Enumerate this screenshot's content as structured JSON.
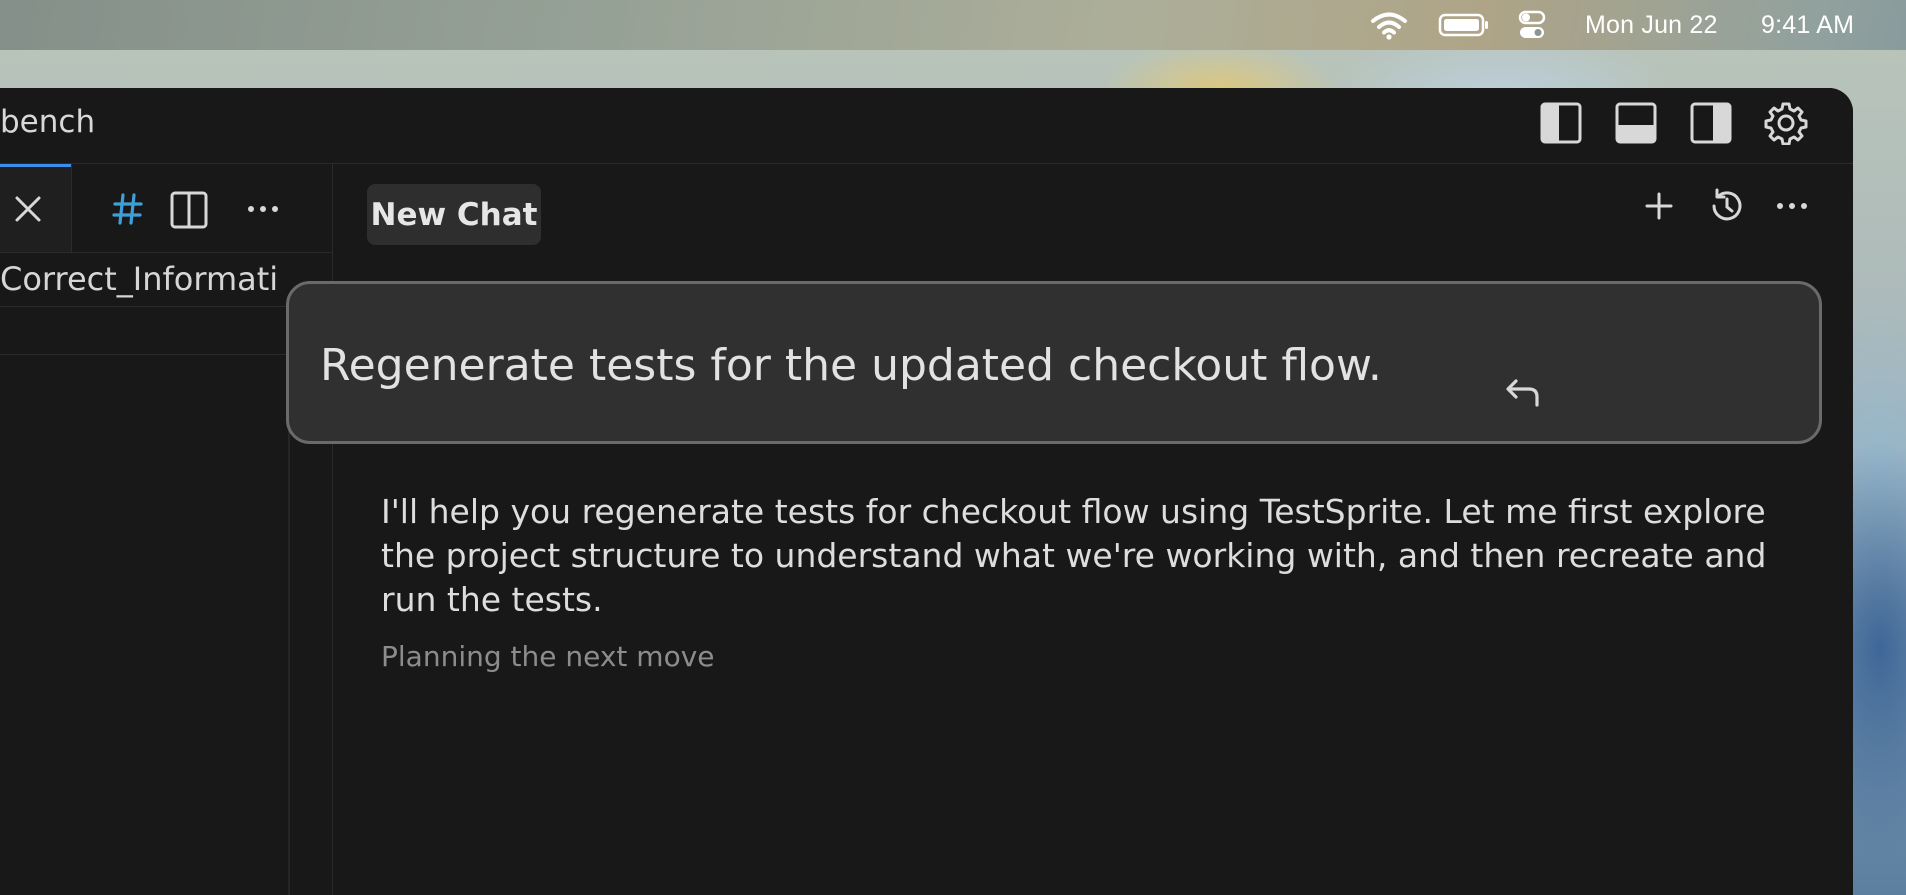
{
  "menubar": {
    "date": "Mon Jun 22",
    "time": "9:41 AM",
    "icons": [
      "wifi-icon",
      "battery-icon",
      "control-center-icon"
    ]
  },
  "window": {
    "title": "bench",
    "toolbar_icons": [
      "toggle-left-sidebar-icon",
      "toggle-bottom-panel-icon",
      "toggle-right-sidebar-icon",
      "settings-gear-icon"
    ]
  },
  "editor": {
    "tab_icons": [
      "close-icon",
      "hash-icon",
      "split-editor-icon",
      "more-icon"
    ],
    "filename": "Correct_Informati"
  },
  "chat": {
    "tab_label": "New Chat",
    "header_icons": [
      "new-chat-plus-icon",
      "history-icon",
      "more-options-icon"
    ],
    "prompt": "Regenerate tests for the updated checkout flow.",
    "response": "I'll help you regenerate tests for checkout flow using TestSprite. Let me first explore the project structure to understand what we're working with, and then recreate and run the tests.",
    "status": "Planning the next move"
  },
  "colors": {
    "window_bg": "#181818",
    "prompt_bg": "#303030",
    "prompt_border": "#6a6a6a",
    "accent": "#3b8eea",
    "hash_icon": "#3fa0d8"
  }
}
